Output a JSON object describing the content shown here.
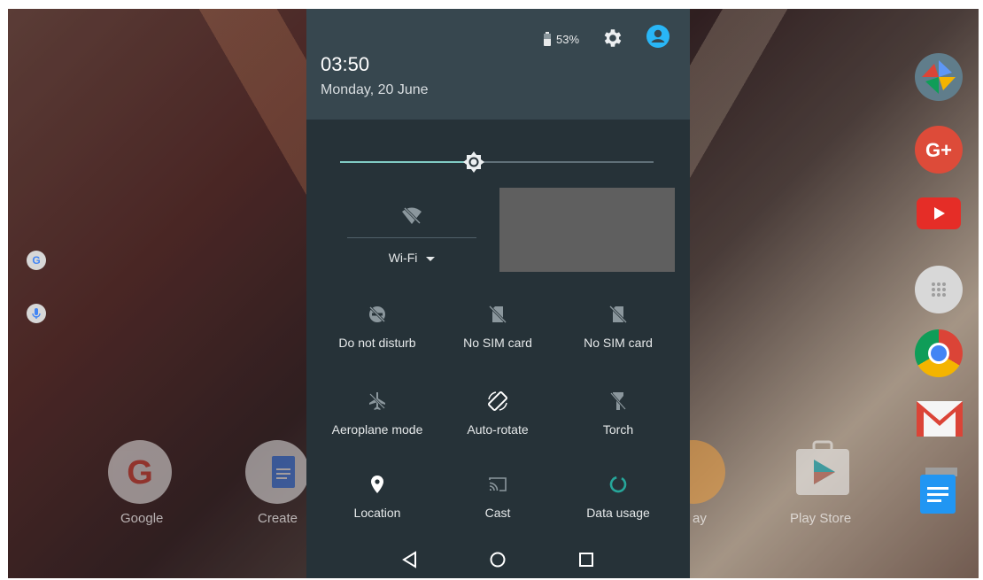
{
  "status_header": {
    "time": "03:50",
    "date": "Monday, 20 June",
    "battery_percent": "53%"
  },
  "brightness": {
    "level_fraction": 0.43
  },
  "wifi": {
    "label": "Wi-Fi"
  },
  "quick_tiles": [
    {
      "label": "Do not disturb",
      "icon": "do-not-disturb-icon"
    },
    {
      "label": "No SIM card",
      "icon": "no-sim-icon"
    },
    {
      "label": "No SIM card",
      "icon": "no-sim-icon"
    },
    {
      "label": "Aeroplane mode",
      "icon": "airplane-icon"
    },
    {
      "label": "Auto-rotate",
      "icon": "auto-rotate-icon"
    },
    {
      "label": "Torch",
      "icon": "torch-icon"
    },
    {
      "label": "Location",
      "icon": "location-icon"
    },
    {
      "label": "Cast",
      "icon": "cast-icon"
    },
    {
      "label": "Data usage",
      "icon": "data-usage-icon"
    }
  ],
  "home_dock": [
    {
      "label": "Google"
    },
    {
      "label": "Create"
    },
    {
      "label": "ay"
    },
    {
      "label": "Play Store"
    }
  ],
  "colors": {
    "shade_bg": "#263238",
    "header_bg": "#37474f",
    "accent": "#80cbc4",
    "data_usage_accent": "#26a69a"
  }
}
